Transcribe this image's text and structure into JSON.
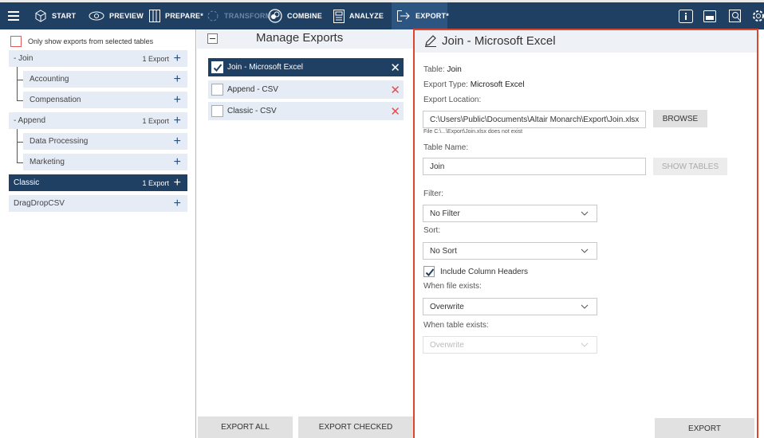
{
  "toolbar": {
    "start": "START",
    "preview": "PREVIEW",
    "prepare": "PREPARE*",
    "transform": "TRANSFORM",
    "combine": "COMBINE",
    "analyze": "ANALYZE",
    "export": "EXPORT*",
    "icons": [
      "menu-icon",
      "cube-icon",
      "eye-icon",
      "columns-icon",
      "transform-icon",
      "combine-icon",
      "analyze-icon",
      "export-icon",
      "info-icon",
      "window-icon",
      "search-icon",
      "gear-icon"
    ]
  },
  "left": {
    "only_show_label": "Only show exports from selected tables",
    "tables": [
      {
        "name": "- Join",
        "count": "1 Export"
      },
      {
        "name": "Accounting",
        "count": ""
      },
      {
        "name": "Compensation",
        "count": ""
      },
      {
        "name": "- Append",
        "count": "1 Export"
      },
      {
        "name": "Data Processing",
        "count": ""
      },
      {
        "name": "Marketing",
        "count": ""
      },
      {
        "name": "Classic",
        "count": "1 Export"
      },
      {
        "name": "DragDropCSV",
        "count": ""
      }
    ],
    "plus": "+"
  },
  "middle": {
    "title": "Manage Exports",
    "exports": [
      {
        "name": "Join - Microsoft Excel",
        "checked": true
      },
      {
        "name": "Append - CSV",
        "checked": false
      },
      {
        "name": "Classic - CSV",
        "checked": false
      }
    ],
    "remove_glyph": "✕",
    "export_all": "EXPORT ALL",
    "export_checked": "EXPORT CHECKED"
  },
  "right": {
    "title": "Join - Microsoft Excel",
    "table_label": "Table:",
    "table_value": "Join",
    "type_label": "Export Type:",
    "type_value": "Microsoft Excel",
    "location_label": "Export Location:",
    "location_value": "C:\\Users\\Public\\Documents\\Altair Monarch\\Export\\Join.xlsx",
    "browse": "BROWSE",
    "location_hint": "File C:\\...\\Export\\Join.xlsx does not exist",
    "table_name_label": "Table Name:",
    "table_name_value": "Join",
    "show_tables": "SHOW TABLES",
    "filter_label": "Filter:",
    "filter_value": "No Filter",
    "sort_label": "Sort:",
    "sort_value": "No Sort",
    "include_headers": "Include Column Headers",
    "file_exists_label": "When file exists:",
    "file_exists_value": "Overwrite",
    "table_exists_label": "When table exists:",
    "table_exists_value": "Overwrite",
    "export": "EXPORT"
  },
  "colors": {
    "toolbar_bg": "#1f3f63",
    "selected_bg": "#1f3f63",
    "row_bg": "#e6ecf5",
    "highlight_border": "#e0452b",
    "remove_red": "#e05050"
  }
}
